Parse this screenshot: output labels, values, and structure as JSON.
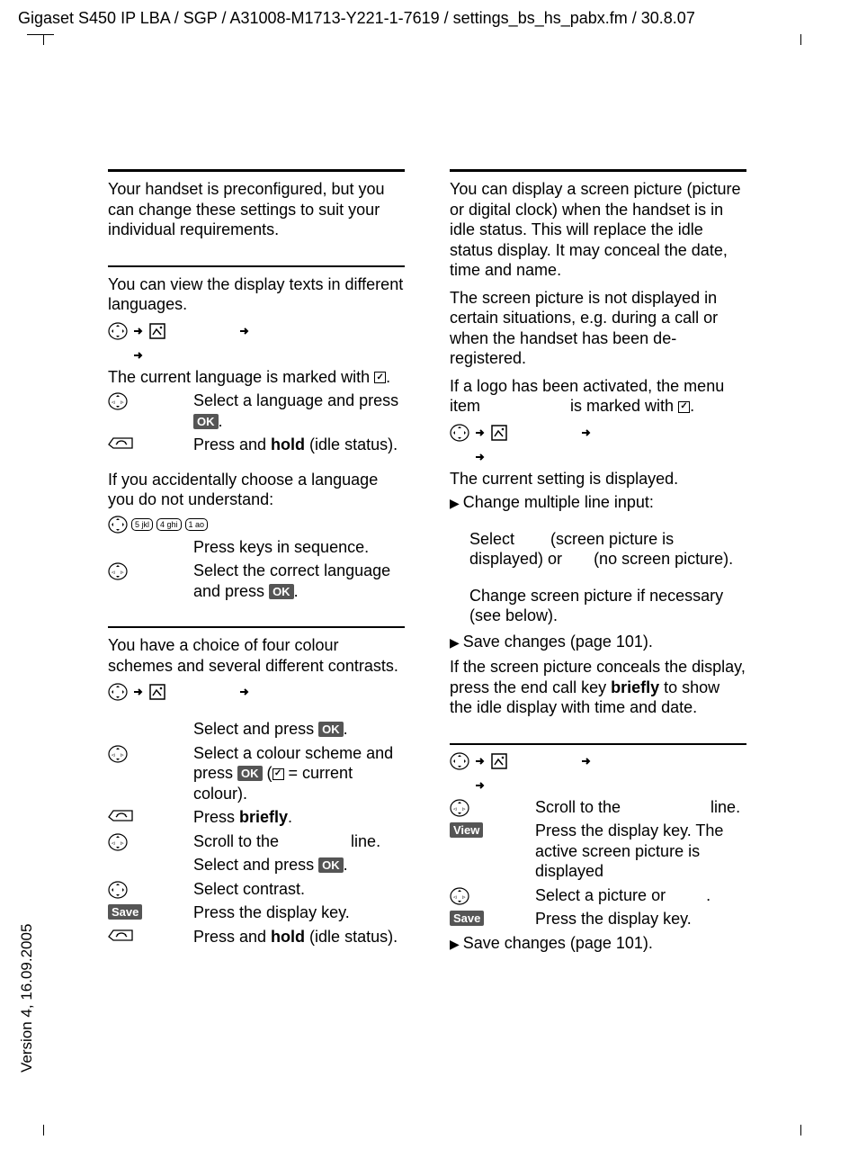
{
  "header": "Gigaset S450 IP LBA / SGP / A31008-M1713-Y221-1-7619 / settings_bs_hs_pabx.fm / 30.8.07",
  "version": "Version 4, 16.09.2005",
  "left": {
    "intro": "Your handset is preconfigured, but you can change these settings to suit your individual requirements.",
    "lang": {
      "p1": "You can view the display texts in different languages.",
      "curLang": "The current language is marked with ",
      "selLang1": "Select a language and press ",
      "hold1": "Press and ",
      "hold1b": "hold",
      "hold1c": " (idle status).",
      "acc": "If you accidentally choose a language you do not understand:",
      "seq": "Press keys in sequence.",
      "corr1": "Select the correct language and press "
    },
    "disp": {
      "p1": "You have a choice of four colour schemes and several different contrasts.",
      "i1a": "Select and press ",
      "i2a": "Select a colour scheme and press ",
      "i2b": " (",
      "i2c": " = current colour).",
      "i3a": "Press ",
      "i3b": "briefly",
      "scroll": "Scroll to the ",
      "line": " line.",
      "i5": "Select and press ",
      "i6": "Select contrast.",
      "i7": "Press the display key.",
      "i8a": "Press and ",
      "i8b": "hold",
      "i8c": " (idle status)."
    }
  },
  "right": {
    "p1": "You can display a screen picture (picture or digital clock) when the handset is in idle status. This will replace the idle status display. It may conceal the date, time and name.",
    "p2": "The screen picture is not displayed in certain situations, e.g. during a call or when the handset has been de-registered.",
    "p3a": "If a logo has been activated, the menu item ",
    "p3b": " is marked with ",
    "cur": "The current setting is displayed.",
    "chg": "Change multiple line input:",
    "sel1": "Select ",
    "sel2": " (screen picture is displayed) or ",
    "sel3": " (no screen picture).",
    "chgpic": "Change screen picture if necessary (see below).",
    "save": "Save changes (page 101).",
    "conc1": "If the screen picture conceals the display, press the end call key ",
    "conc2": "briefly",
    "conc3": " to show the idle display with time and date.",
    "scroll": "Scroll to the ",
    "line": " line.",
    "view": "Press the display key. The active screen picture is displayed",
    "selpic": "Select a picture or ",
    "saveKey": "Press the display key.",
    "save2": "Save changes (page 101)."
  },
  "labels": {
    "ok": "OK",
    "save": "Save",
    "view": "View"
  }
}
